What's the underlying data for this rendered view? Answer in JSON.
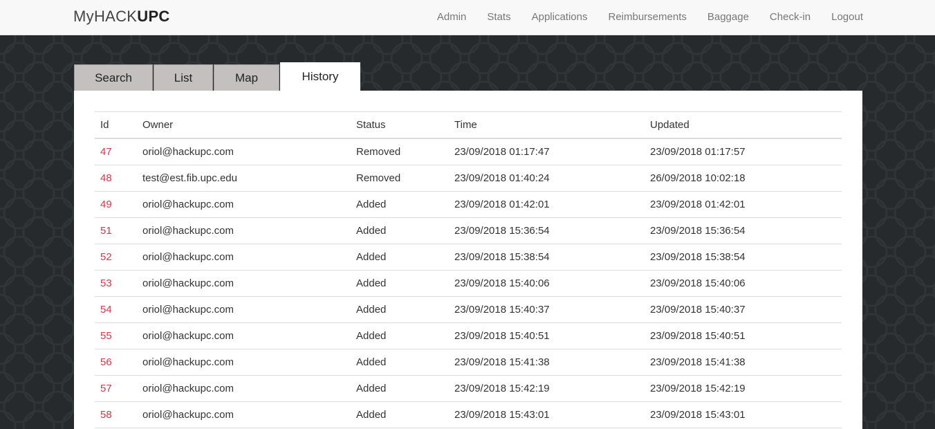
{
  "brand": {
    "prefix": "My",
    "middle": "HACK",
    "suffix": "UPC"
  },
  "nav": {
    "items": [
      {
        "label": "Admin"
      },
      {
        "label": "Stats"
      },
      {
        "label": "Applications"
      },
      {
        "label": "Reimbursements"
      },
      {
        "label": "Baggage"
      },
      {
        "label": "Check-in"
      },
      {
        "label": "Logout"
      }
    ]
  },
  "tabs": [
    {
      "label": "Search"
    },
    {
      "label": "List"
    },
    {
      "label": "Map"
    },
    {
      "label": "History",
      "active": true
    }
  ],
  "table": {
    "headers": [
      "Id",
      "Owner",
      "Status",
      "Time",
      "Updated"
    ],
    "rows": [
      [
        "47",
        "oriol@hackupc.com",
        "Removed",
        "23/09/2018 01:17:47",
        "23/09/2018 01:17:57"
      ],
      [
        "48",
        "test@est.fib.upc.edu",
        "Removed",
        "23/09/2018 01:40:24",
        "26/09/2018 10:02:18"
      ],
      [
        "49",
        "oriol@hackupc.com",
        "Added",
        "23/09/2018 01:42:01",
        "23/09/2018 01:42:01"
      ],
      [
        "51",
        "oriol@hackupc.com",
        "Added",
        "23/09/2018 15:36:54",
        "23/09/2018 15:36:54"
      ],
      [
        "52",
        "oriol@hackupc.com",
        "Added",
        "23/09/2018 15:38:54",
        "23/09/2018 15:38:54"
      ],
      [
        "53",
        "oriol@hackupc.com",
        "Added",
        "23/09/2018 15:40:06",
        "23/09/2018 15:40:06"
      ],
      [
        "54",
        "oriol@hackupc.com",
        "Added",
        "23/09/2018 15:40:37",
        "23/09/2018 15:40:37"
      ],
      [
        "55",
        "oriol@hackupc.com",
        "Added",
        "23/09/2018 15:40:51",
        "23/09/2018 15:40:51"
      ],
      [
        "56",
        "oriol@hackupc.com",
        "Added",
        "23/09/2018 15:41:38",
        "23/09/2018 15:41:38"
      ],
      [
        "57",
        "oriol@hackupc.com",
        "Added",
        "23/09/2018 15:42:19",
        "23/09/2018 15:42:19"
      ],
      [
        "58",
        "oriol@hackupc.com",
        "Added",
        "23/09/2018 15:43:01",
        "23/09/2018 15:43:01"
      ]
    ]
  },
  "colors": {
    "background": "#262a2d",
    "navbar": "#f8f8f8",
    "link_accent": "#d8344a",
    "tab_inactive": "#c3c0bf"
  }
}
